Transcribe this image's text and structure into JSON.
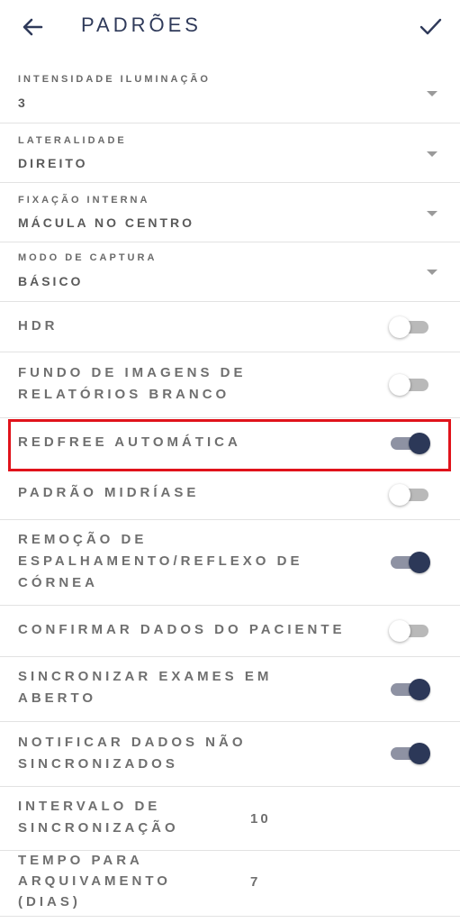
{
  "header": {
    "title": "PADRÕES",
    "back_icon": "arrow-left-icon",
    "confirm_icon": "check-icon"
  },
  "dropdowns": [
    {
      "label": "INTENSIDADE ILUMINAÇÃO",
      "value": "3"
    },
    {
      "label": "LATERALIDADE",
      "value": "DIREITO"
    },
    {
      "label": "FIXAÇÃO INTERNA",
      "value": "MÁCULA NO CENTRO"
    },
    {
      "label": "MODO DE CAPTURA",
      "value": "BÁSICO"
    }
  ],
  "toggles": [
    {
      "lines": [
        "HDR"
      ],
      "on": false
    },
    {
      "lines": [
        "FUNDO DE IMAGENS DE",
        "RELATÓRIOS BRANCO"
      ],
      "on": false
    },
    {
      "lines": [
        "REDFREE AUTOMÁTICA"
      ],
      "on": true
    },
    {
      "lines": [
        "PADRÃO MIDRÍASE"
      ],
      "on": false
    },
    {
      "lines": [
        "REMOÇÃO DE",
        "ESPALHAMENTO/REFLEXO DE",
        "CÓRNEA"
      ],
      "on": true
    },
    {
      "lines": [
        "CONFIRMAR DADOS DO PACIENTE"
      ],
      "on": false
    },
    {
      "lines": [
        "SINCRONIZAR EXAMES EM",
        "ABERTO"
      ],
      "on": true
    },
    {
      "lines": [
        "NOTIFICAR DADOS NÃO",
        "SINCRONIZADOS"
      ],
      "on": true
    }
  ],
  "numeric": [
    {
      "lines": [
        "INTERVALO DE",
        "SINCRONIZAÇÃO"
      ],
      "value": "10"
    },
    {
      "lines": [
        "TEMPO PARA",
        "ARQUIVAMENTO",
        "(DIAS)"
      ],
      "value": "7"
    }
  ],
  "colors": {
    "accent": "#2c3858",
    "highlight": "#e0131b"
  }
}
